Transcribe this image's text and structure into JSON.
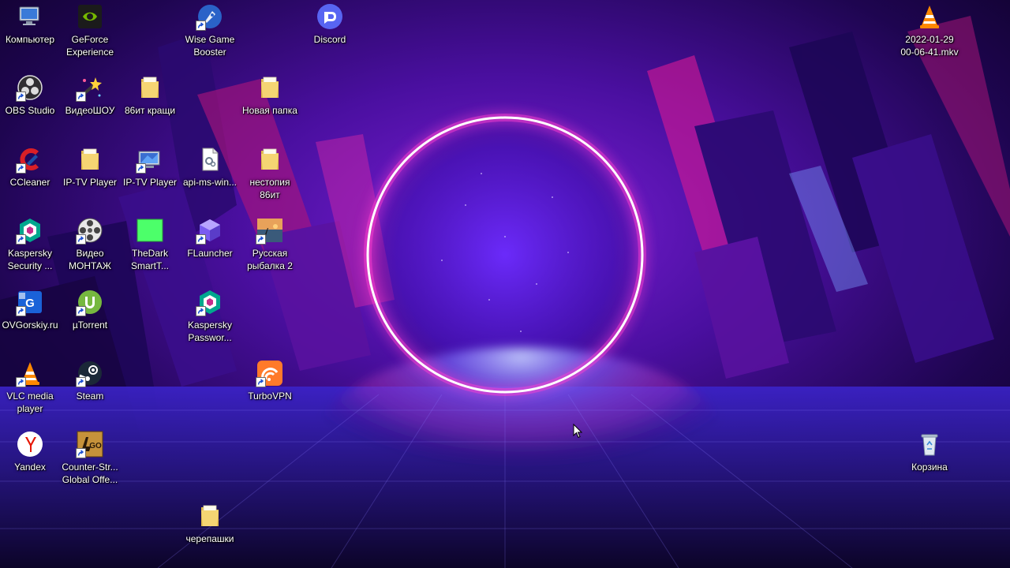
{
  "desktop": {
    "icons": [
      {
        "key": "computer",
        "label": "Компьютер",
        "icon": "computer-icon",
        "shortcut": false
      },
      {
        "key": "geforce",
        "label": "GeForce\nExperience",
        "icon": "nvidia-icon",
        "shortcut": false
      },
      {
        "key": "wise",
        "label": "Wise Game\nBooster",
        "icon": "rocket-icon",
        "shortcut": true
      },
      {
        "key": "discord",
        "label": "Discord",
        "icon": "discord-icon",
        "shortcut": false
      },
      {
        "key": "vlc-file",
        "label": "2022-01-29\n00-06-41.mkv",
        "icon": "vlc-cone-icon",
        "shortcut": false
      },
      {
        "key": "obs",
        "label": "OBS Studio",
        "icon": "obs-icon",
        "shortcut": true
      },
      {
        "key": "videoshow",
        "label": "ВидеоШОУ",
        "icon": "magic-wand-icon",
        "shortcut": true
      },
      {
        "key": "folder86",
        "label": "86ит кращи",
        "icon": "folder-icon",
        "shortcut": false
      },
      {
        "key": "newfolder",
        "label": "Новая папка",
        "icon": "folder-icon",
        "shortcut": false
      },
      {
        "key": "ccleaner",
        "label": "CCleaner",
        "icon": "ccleaner-icon",
        "shortcut": true
      },
      {
        "key": "iptv1",
        "label": "IP-TV Player",
        "icon": "folder-icon",
        "shortcut": false
      },
      {
        "key": "iptv2",
        "label": "IP-TV Player",
        "icon": "tv-icon",
        "shortcut": true
      },
      {
        "key": "apims",
        "label": "api-ms-win...",
        "icon": "dll-file-icon",
        "shortcut": false
      },
      {
        "key": "nestopia",
        "label": "нестопия\n86ит",
        "icon": "folder-icon",
        "shortcut": false
      },
      {
        "key": "kaspersky",
        "label": "Kaspersky\nSecurity ...",
        "icon": "kaspersky-icon",
        "shortcut": true
      },
      {
        "key": "videomontazh",
        "label": "Видео\nМОНТАЖ",
        "icon": "film-reel-icon",
        "shortcut": true
      },
      {
        "key": "thedark",
        "label": "TheDark\nSmartT...",
        "icon": "green-image-icon",
        "shortcut": false
      },
      {
        "key": "flauncher",
        "label": "FLauncher",
        "icon": "cube-icon",
        "shortcut": true
      },
      {
        "key": "fishing",
        "label": "Русская\nрыбалка 2",
        "icon": "fishing-icon",
        "shortcut": true
      },
      {
        "key": "ovgorskiy",
        "label": "OVGorskiy.ru",
        "icon": "ovg-icon",
        "shortcut": true
      },
      {
        "key": "utorrent",
        "label": "µTorrent",
        "icon": "utorrent-icon",
        "shortcut": true
      },
      {
        "key": "kpassword",
        "label": "Kaspersky\nPasswor...",
        "icon": "kaspersky-icon",
        "shortcut": true
      },
      {
        "key": "vlc",
        "label": "VLC media\nplayer",
        "icon": "vlc-cone-icon",
        "shortcut": true
      },
      {
        "key": "steam",
        "label": "Steam",
        "icon": "steam-icon",
        "shortcut": true
      },
      {
        "key": "turbovpn",
        "label": "TurboVPN",
        "icon": "turbovpn-icon",
        "shortcut": true
      },
      {
        "key": "yandex",
        "label": "Yandex",
        "icon": "yandex-icon",
        "shortcut": false
      },
      {
        "key": "csgo",
        "label": "Counter-Str...\nGlobal Offe...",
        "icon": "csgo-icon",
        "shortcut": true
      },
      {
        "key": "trash",
        "label": "Корзина",
        "icon": "recycle-bin-icon",
        "shortcut": false
      },
      {
        "key": "cherepashki",
        "label": "черепашки",
        "icon": "folder-icon",
        "shortcut": false
      }
    ]
  },
  "colors": {
    "ring": "#ff4fd8",
    "ring_core": "#ffffff",
    "wall_dark": "#10022a",
    "wall_mid": "#4a0fa0",
    "floor_glow": "#6a7cff"
  }
}
